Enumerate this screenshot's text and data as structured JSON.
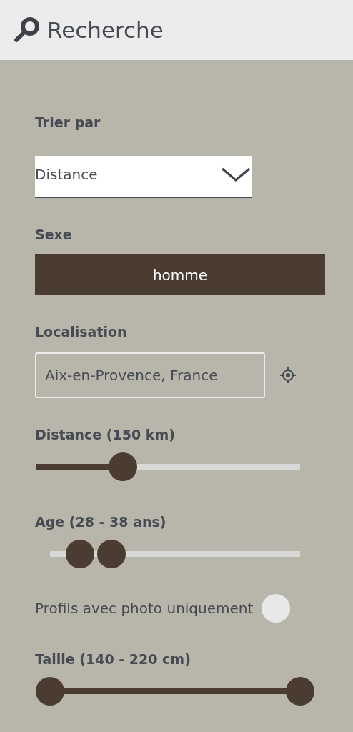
{
  "header": {
    "title": "Recherche"
  },
  "sort": {
    "label": "Trier par",
    "value": "Distance"
  },
  "gender": {
    "label": "Sexe",
    "button": "homme"
  },
  "location": {
    "label": "Localisation",
    "value": "Aix-en-Provence, France"
  },
  "sliders": [
    {
      "label": "Distance (150 km)",
      "kind": "single",
      "handles": [
        {
          "level": 0.29
        }
      ]
    },
    {
      "label": "Age (28 - 38 ans)",
      "kind": "range",
      "handles": [
        {
          "level": 0.12
        },
        {
          "level": 0.245
        }
      ]
    }
  ],
  "photo_only": {
    "label": "Profils avec photo uniquement",
    "on": false
  },
  "height_slider": {
    "label": "Taille (140 - 220 cm)"
  }
}
